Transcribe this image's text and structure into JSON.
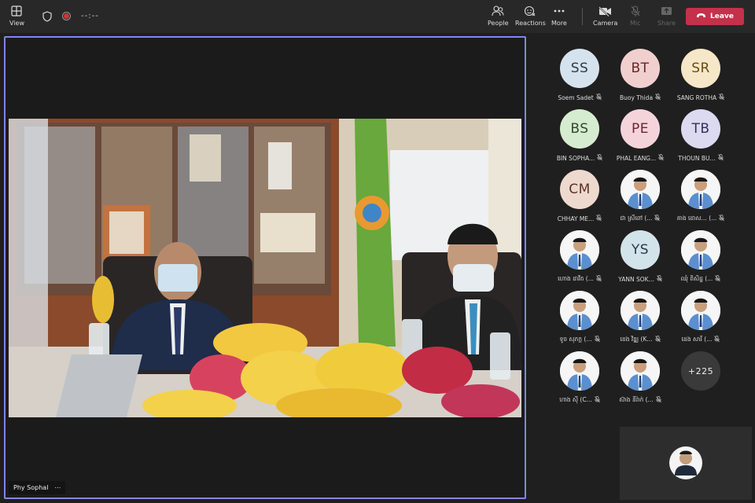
{
  "toolbar": {
    "view_label": "View",
    "timer": "--:--",
    "people_label": "People",
    "reactions_label": "Reactions",
    "more_label": "More",
    "camera_label": "Camera",
    "mic_label": "Mic",
    "share_label": "Share",
    "leave_label": "Leave"
  },
  "stage": {
    "speaker_name": "Phy Sophal",
    "more_glyph": "⋯"
  },
  "participants": [
    {
      "initials": "SS",
      "name": "Soem Sadet",
      "bg": "#d5e3ee",
      "fg": "#2b3a4a",
      "photo": false
    },
    {
      "initials": "BT",
      "name": "Buoy Thida",
      "bg": "#f2cfcf",
      "fg": "#6a2525",
      "photo": false
    },
    {
      "initials": "SR",
      "name": "SANG ROTHA",
      "bg": "#f6e7c8",
      "fg": "#6b4c12",
      "photo": false
    },
    {
      "initials": "BS",
      "name": "BIN SOPHA...",
      "bg": "#d6ecd0",
      "fg": "#2e4a27",
      "photo": false
    },
    {
      "initials": "PE",
      "name": "PHAL EANG...",
      "bg": "#f4d4da",
      "fg": "#6d2434",
      "photo": false
    },
    {
      "initials": "TB",
      "name": "THOUN BU...",
      "bg": "#dcdaf0",
      "fg": "#31305a",
      "photo": false
    },
    {
      "initials": "CM",
      "name": "CHHAY ME...",
      "bg": "#eed9cf",
      "fg": "#5a3425",
      "photo": false
    },
    {
      "initials": "",
      "name": "ជា ស្រីពៅ (...",
      "bg": "#ffffff",
      "fg": "#000",
      "photo": true
    },
    {
      "initials": "",
      "name": "គាង ដោស... (...",
      "bg": "#ffffff",
      "fg": "#000",
      "photo": true
    },
    {
      "initials": "",
      "name": "ហោង ដាវីត (...",
      "bg": "#ffffff",
      "fg": "#000",
      "photo": true
    },
    {
      "initials": "YS",
      "name": "YANN SOK...",
      "bg": "#d3e3ea",
      "fg": "#263c46",
      "photo": false
    },
    {
      "initials": "",
      "name": "ឈុំ ពិសិដ្ឋ (...",
      "bg": "#ffffff",
      "fg": "#000",
      "photo": true
    },
    {
      "initials": "",
      "name": "ទូច សុភក្ដ (...",
      "bg": "#ffffff",
      "fg": "#000",
      "photo": true
    },
    {
      "initials": "",
      "name": "ខេង វិឌ្ឍ (K...",
      "bg": "#ffffff",
      "fg": "#000",
      "photo": true
    },
    {
      "initials": "",
      "name": "ដេង សារី (...",
      "bg": "#ffffff",
      "fg": "#000",
      "photo": true
    },
    {
      "initials": "",
      "name": "ហាង ស៊ី (C...",
      "bg": "#ffffff",
      "fg": "#000",
      "photo": true
    },
    {
      "initials": "",
      "name": "ស៊ាង នីរ៉ាក់ (...",
      "bg": "#ffffff",
      "fg": "#000",
      "photo": true
    },
    {
      "initials": "+225",
      "name": "",
      "bg": "#3b3a3a",
      "fg": "#eeeeee",
      "photo": false,
      "overflow": true
    }
  ],
  "colors": {
    "accent": "#7f85f5",
    "leave": "#c4314b",
    "background": "#201f1f"
  }
}
